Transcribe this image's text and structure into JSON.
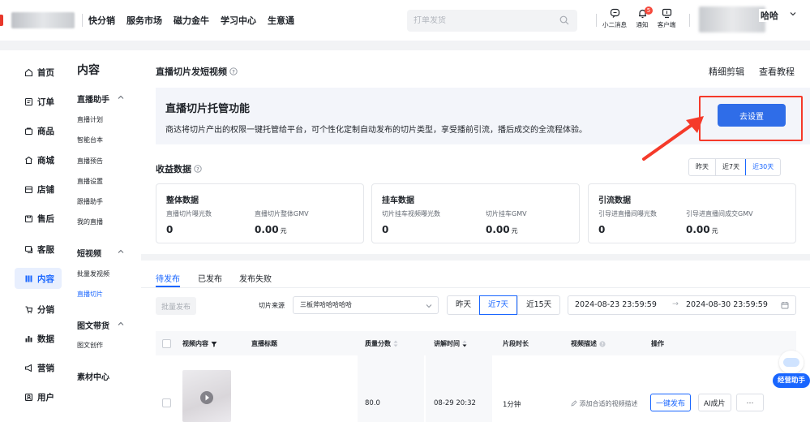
{
  "header": {
    "nav": [
      "快分销",
      "服务市场",
      "磁力金牛",
      "学习中心",
      "生意通"
    ],
    "search_placeholder": "打单发货",
    "tools": [
      {
        "label": "小二消息",
        "icon": "message-icon"
      },
      {
        "label": "通知",
        "icon": "bell-icon",
        "badge": "5"
      },
      {
        "label": "客户端",
        "icon": "monitor-icon"
      }
    ],
    "user_name": "哈哈"
  },
  "sidebar": {
    "primary": [
      {
        "label": "首页",
        "icon": "home-icon"
      },
      {
        "label": "订单",
        "icon": "order-icon"
      },
      {
        "label": "商品",
        "icon": "goods-icon"
      },
      {
        "label": "商城",
        "icon": "mall-icon"
      },
      {
        "label": "店铺",
        "icon": "shop-icon"
      },
      {
        "label": "售后",
        "icon": "aftersale-icon"
      },
      {
        "label": "客服",
        "icon": "service-icon"
      },
      {
        "label": "内容",
        "icon": "content-icon",
        "active": true
      },
      {
        "label": "分销",
        "icon": "distribution-icon"
      },
      {
        "label": "数据",
        "icon": "chart-icon"
      },
      {
        "label": "营销",
        "icon": "megaphone-icon"
      },
      {
        "label": "用户",
        "icon": "user-icon"
      }
    ],
    "section_title": "内容",
    "groups": [
      {
        "title": "直播助手",
        "items": [
          "直播计划",
          "智能台本",
          "直播预告",
          "直播设置",
          "跟播助手",
          "我的直播"
        ]
      },
      {
        "title": "短视频",
        "items": [
          "批量发视频",
          "直播切片"
        ]
      },
      {
        "title": "图文带货",
        "items": [
          "图文创作"
        ]
      },
      {
        "title": "素材中心",
        "items": []
      }
    ],
    "active_sub": "直播切片"
  },
  "main": {
    "title": "直播切片发短视频",
    "links": [
      "精细剪辑",
      "查看教程"
    ],
    "promo": {
      "title": "直播切片托管功能",
      "desc": "商达将切片产出的权限一键托管给平台，可个性化定制自动发布的切片类型，享受播前引流，播后成交的全流程体验。",
      "button": "去设置"
    },
    "income": {
      "title": "收益数据",
      "ranges": [
        "昨天",
        "近7天",
        "近30天"
      ],
      "active_range": "近30天",
      "cards": [
        {
          "title": "整体数据",
          "metrics": [
            {
              "label": "直播切片曝光数",
              "value": "0"
            },
            {
              "label": "直播切片整体GMV",
              "value": "0.00",
              "unit": "元"
            }
          ]
        },
        {
          "title": "挂车数据",
          "metrics": [
            {
              "label": "切片挂车视频曝光数",
              "value": "0"
            },
            {
              "label": "切片挂车GMV",
              "value": "0.00",
              "unit": "元"
            }
          ]
        },
        {
          "title": "引流数据",
          "metrics": [
            {
              "label": "引导进直播间曝光数",
              "value": "0"
            },
            {
              "label": "引导进直播间成交GMV",
              "value": "0.00",
              "unit": "元"
            }
          ]
        }
      ]
    },
    "tabs": [
      "待发布",
      "已发布",
      "发布失败"
    ],
    "active_tab": "待发布",
    "filters": {
      "batch_button": "批量发布",
      "source_label": "切片来源",
      "source_value": "三板斧哈哈哈哈哈",
      "ranges": [
        "昨天",
        "近7天",
        "近15天"
      ],
      "active_range": "近7天",
      "date_start": "2024-08-23 23:59:59",
      "date_sep": "→",
      "date_end": "2024-08-30 23:59:59"
    },
    "table": {
      "columns": [
        "视频内容",
        "直播标题",
        "质量分数",
        "讲解时间",
        "片段时长",
        "视频描述",
        "操作"
      ],
      "rows": [
        {
          "title": "",
          "score": "80.0",
          "time": "08-29 20:32",
          "duration": "1分钟",
          "desc": "添加合适的视频描述",
          "actions": [
            "一键发布",
            "AI成片",
            "···"
          ]
        }
      ]
    },
    "helper_label": "经营助手"
  },
  "colors": {
    "accent": "#1966ff",
    "button": "#2f6de8",
    "annotation_red": "#f53a2a"
  }
}
